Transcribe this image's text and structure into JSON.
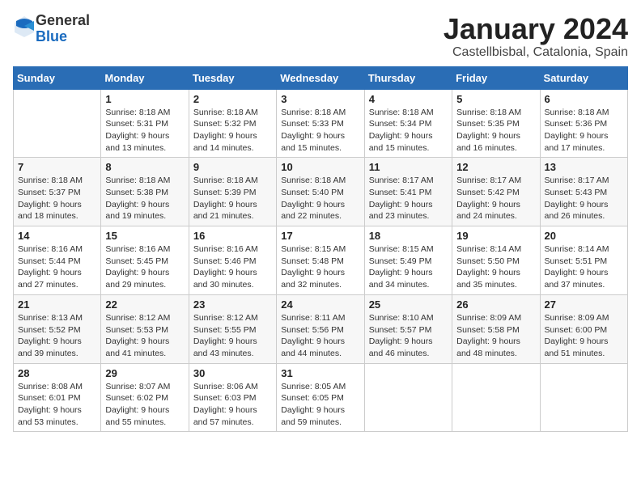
{
  "header": {
    "logo_general": "General",
    "logo_blue": "Blue",
    "title": "January 2024",
    "subtitle": "Castellbisbal, Catalonia, Spain"
  },
  "weekdays": [
    "Sunday",
    "Monday",
    "Tuesday",
    "Wednesday",
    "Thursday",
    "Friday",
    "Saturday"
  ],
  "weeks": [
    [
      {
        "day": "",
        "sunrise": "",
        "sunset": "",
        "daylight": ""
      },
      {
        "day": "1",
        "sunrise": "Sunrise: 8:18 AM",
        "sunset": "Sunset: 5:31 PM",
        "daylight": "Daylight: 9 hours and 13 minutes."
      },
      {
        "day": "2",
        "sunrise": "Sunrise: 8:18 AM",
        "sunset": "Sunset: 5:32 PM",
        "daylight": "Daylight: 9 hours and 14 minutes."
      },
      {
        "day": "3",
        "sunrise": "Sunrise: 8:18 AM",
        "sunset": "Sunset: 5:33 PM",
        "daylight": "Daylight: 9 hours and 15 minutes."
      },
      {
        "day": "4",
        "sunrise": "Sunrise: 8:18 AM",
        "sunset": "Sunset: 5:34 PM",
        "daylight": "Daylight: 9 hours and 15 minutes."
      },
      {
        "day": "5",
        "sunrise": "Sunrise: 8:18 AM",
        "sunset": "Sunset: 5:35 PM",
        "daylight": "Daylight: 9 hours and 16 minutes."
      },
      {
        "day": "6",
        "sunrise": "Sunrise: 8:18 AM",
        "sunset": "Sunset: 5:36 PM",
        "daylight": "Daylight: 9 hours and 17 minutes."
      }
    ],
    [
      {
        "day": "7",
        "sunrise": "Sunrise: 8:18 AM",
        "sunset": "Sunset: 5:37 PM",
        "daylight": "Daylight: 9 hours and 18 minutes."
      },
      {
        "day": "8",
        "sunrise": "Sunrise: 8:18 AM",
        "sunset": "Sunset: 5:38 PM",
        "daylight": "Daylight: 9 hours and 19 minutes."
      },
      {
        "day": "9",
        "sunrise": "Sunrise: 8:18 AM",
        "sunset": "Sunset: 5:39 PM",
        "daylight": "Daylight: 9 hours and 21 minutes."
      },
      {
        "day": "10",
        "sunrise": "Sunrise: 8:18 AM",
        "sunset": "Sunset: 5:40 PM",
        "daylight": "Daylight: 9 hours and 22 minutes."
      },
      {
        "day": "11",
        "sunrise": "Sunrise: 8:17 AM",
        "sunset": "Sunset: 5:41 PM",
        "daylight": "Daylight: 9 hours and 23 minutes."
      },
      {
        "day": "12",
        "sunrise": "Sunrise: 8:17 AM",
        "sunset": "Sunset: 5:42 PM",
        "daylight": "Daylight: 9 hours and 24 minutes."
      },
      {
        "day": "13",
        "sunrise": "Sunrise: 8:17 AM",
        "sunset": "Sunset: 5:43 PM",
        "daylight": "Daylight: 9 hours and 26 minutes."
      }
    ],
    [
      {
        "day": "14",
        "sunrise": "Sunrise: 8:16 AM",
        "sunset": "Sunset: 5:44 PM",
        "daylight": "Daylight: 9 hours and 27 minutes."
      },
      {
        "day": "15",
        "sunrise": "Sunrise: 8:16 AM",
        "sunset": "Sunset: 5:45 PM",
        "daylight": "Daylight: 9 hours and 29 minutes."
      },
      {
        "day": "16",
        "sunrise": "Sunrise: 8:16 AM",
        "sunset": "Sunset: 5:46 PM",
        "daylight": "Daylight: 9 hours and 30 minutes."
      },
      {
        "day": "17",
        "sunrise": "Sunrise: 8:15 AM",
        "sunset": "Sunset: 5:48 PM",
        "daylight": "Daylight: 9 hours and 32 minutes."
      },
      {
        "day": "18",
        "sunrise": "Sunrise: 8:15 AM",
        "sunset": "Sunset: 5:49 PM",
        "daylight": "Daylight: 9 hours and 34 minutes."
      },
      {
        "day": "19",
        "sunrise": "Sunrise: 8:14 AM",
        "sunset": "Sunset: 5:50 PM",
        "daylight": "Daylight: 9 hours and 35 minutes."
      },
      {
        "day": "20",
        "sunrise": "Sunrise: 8:14 AM",
        "sunset": "Sunset: 5:51 PM",
        "daylight": "Daylight: 9 hours and 37 minutes."
      }
    ],
    [
      {
        "day": "21",
        "sunrise": "Sunrise: 8:13 AM",
        "sunset": "Sunset: 5:52 PM",
        "daylight": "Daylight: 9 hours and 39 minutes."
      },
      {
        "day": "22",
        "sunrise": "Sunrise: 8:12 AM",
        "sunset": "Sunset: 5:53 PM",
        "daylight": "Daylight: 9 hours and 41 minutes."
      },
      {
        "day": "23",
        "sunrise": "Sunrise: 8:12 AM",
        "sunset": "Sunset: 5:55 PM",
        "daylight": "Daylight: 9 hours and 43 minutes."
      },
      {
        "day": "24",
        "sunrise": "Sunrise: 8:11 AM",
        "sunset": "Sunset: 5:56 PM",
        "daylight": "Daylight: 9 hours and 44 minutes."
      },
      {
        "day": "25",
        "sunrise": "Sunrise: 8:10 AM",
        "sunset": "Sunset: 5:57 PM",
        "daylight": "Daylight: 9 hours and 46 minutes."
      },
      {
        "day": "26",
        "sunrise": "Sunrise: 8:09 AM",
        "sunset": "Sunset: 5:58 PM",
        "daylight": "Daylight: 9 hours and 48 minutes."
      },
      {
        "day": "27",
        "sunrise": "Sunrise: 8:09 AM",
        "sunset": "Sunset: 6:00 PM",
        "daylight": "Daylight: 9 hours and 51 minutes."
      }
    ],
    [
      {
        "day": "28",
        "sunrise": "Sunrise: 8:08 AM",
        "sunset": "Sunset: 6:01 PM",
        "daylight": "Daylight: 9 hours and 53 minutes."
      },
      {
        "day": "29",
        "sunrise": "Sunrise: 8:07 AM",
        "sunset": "Sunset: 6:02 PM",
        "daylight": "Daylight: 9 hours and 55 minutes."
      },
      {
        "day": "30",
        "sunrise": "Sunrise: 8:06 AM",
        "sunset": "Sunset: 6:03 PM",
        "daylight": "Daylight: 9 hours and 57 minutes."
      },
      {
        "day": "31",
        "sunrise": "Sunrise: 8:05 AM",
        "sunset": "Sunset: 6:05 PM",
        "daylight": "Daylight: 9 hours and 59 minutes."
      },
      {
        "day": "",
        "sunrise": "",
        "sunset": "",
        "daylight": ""
      },
      {
        "day": "",
        "sunrise": "",
        "sunset": "",
        "daylight": ""
      },
      {
        "day": "",
        "sunrise": "",
        "sunset": "",
        "daylight": ""
      }
    ]
  ]
}
